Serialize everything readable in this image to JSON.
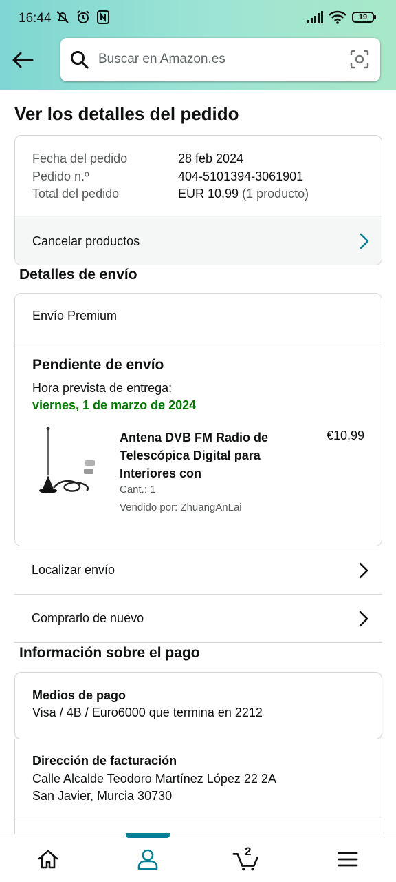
{
  "status_bar": {
    "time": "16:44",
    "battery": "19"
  },
  "search": {
    "placeholder": "Buscar en Amazon.es"
  },
  "page": {
    "title": "Ver los detalles del pedido"
  },
  "order": {
    "labels": [
      "Fecha del pedido",
      "Pedido n.º",
      "Total del pedido"
    ],
    "date": "28 feb 2024",
    "number": "404-5101394-3061901",
    "total": "EUR 10,99",
    "total_count": "(1 producto)",
    "cancel_label": "Cancelar productos"
  },
  "shipping": {
    "section_title": "Detalles de envío",
    "type": "Envío Premium",
    "status": "Pendiente de envío",
    "delivery_label": "Hora prevista de entrega:",
    "delivery_date": "viernes, 1 de marzo de 2024",
    "product": {
      "title": "Antena DVB FM Radio de Telescópica Digital para Interiores con",
      "price": "€10,99",
      "quantity": "Cant.: 1",
      "seller": "Vendido por: ZhuangAnLai"
    }
  },
  "actions": {
    "track": "Localizar envío",
    "buy_again": "Comprarlo de nuevo"
  },
  "payment": {
    "section_title": "Información sobre el pago",
    "methods_title": "Medios de pago",
    "methods_value": "Visa / 4B / Euro6000  que termina en 2212",
    "billing_title": "Dirección de facturación",
    "billing_line1": "Calle Alcalde Teodoro Martínez López 22 2A",
    "billing_line2": "San Javier, Murcia 30730"
  },
  "bottom_nav": {
    "cart_count": "2",
    "active": "account"
  },
  "colors": {
    "accent": "#008296",
    "delivery_green": "#007600",
    "header_gradient_start": "#7fd6d2",
    "header_gradient_end": "#a8e8c8"
  }
}
